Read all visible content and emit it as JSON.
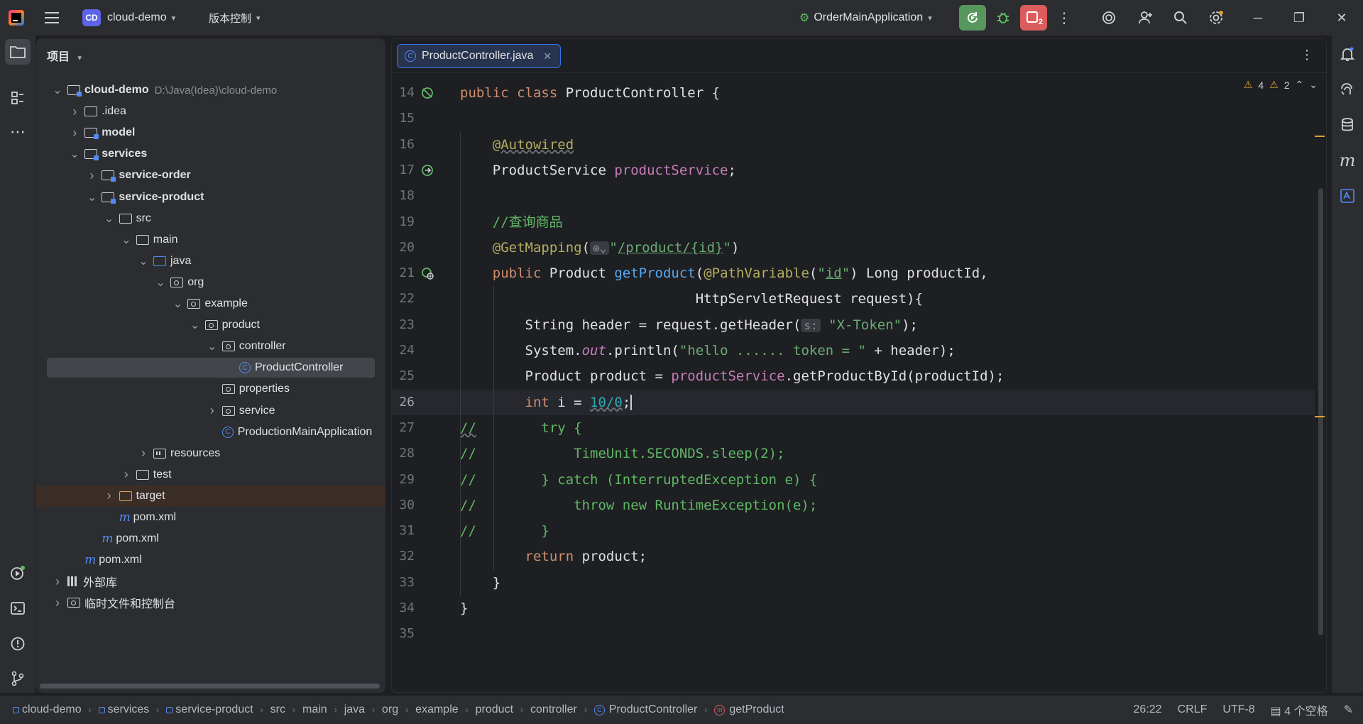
{
  "titlebar": {
    "project_initials": "CD",
    "project_name": "cloud-demo",
    "vcs_label": "版本控制",
    "run_config": "OrderMainApplication",
    "stop_badge": "2"
  },
  "project_panel": {
    "title": "项目",
    "tree": [
      {
        "label": "cloud-demo",
        "path": "D:\\Java(Idea)\\cloud-demo",
        "bold": true,
        "indent": 0,
        "arrow": "down",
        "icon": "module"
      },
      {
        "label": ".idea",
        "indent": 1,
        "arrow": "right",
        "icon": "folder"
      },
      {
        "label": "model",
        "bold": true,
        "indent": 1,
        "arrow": "right",
        "icon": "module"
      },
      {
        "label": "services",
        "bold": true,
        "indent": 1,
        "arrow": "down",
        "icon": "module"
      },
      {
        "label": "service-order",
        "bold": true,
        "indent": 2,
        "arrow": "right",
        "icon": "module"
      },
      {
        "label": "service-product",
        "bold": true,
        "indent": 2,
        "arrow": "down",
        "icon": "module"
      },
      {
        "label": "src",
        "indent": 3,
        "arrow": "down",
        "icon": "folder"
      },
      {
        "label": "main",
        "indent": 4,
        "arrow": "down",
        "icon": "folder"
      },
      {
        "label": "java",
        "indent": 5,
        "arrow": "down",
        "icon": "source"
      },
      {
        "label": "org",
        "indent": 6,
        "arrow": "down",
        "icon": "package"
      },
      {
        "label": "example",
        "indent": 7,
        "arrow": "down",
        "icon": "package"
      },
      {
        "label": "product",
        "indent": 8,
        "arrow": "down",
        "icon": "package"
      },
      {
        "label": "controller",
        "indent": 9,
        "arrow": "down",
        "icon": "package"
      },
      {
        "label": "ProductController",
        "indent": 10,
        "arrow": "",
        "icon": "class",
        "selected": true
      },
      {
        "label": "properties",
        "indent": 9,
        "arrow": "",
        "icon": "package"
      },
      {
        "label": "service",
        "indent": 9,
        "arrow": "right",
        "icon": "package"
      },
      {
        "label": "ProductionMainApplication",
        "indent": 9,
        "arrow": "",
        "icon": "class"
      },
      {
        "label": "resources",
        "indent": 5,
        "arrow": "right",
        "icon": "resources"
      },
      {
        "label": "test",
        "indent": 4,
        "arrow": "right",
        "icon": "folder"
      },
      {
        "label": "target",
        "indent": 3,
        "arrow": "right",
        "icon": "excluded",
        "target": true
      },
      {
        "label": "pom.xml",
        "indent": 3,
        "arrow": "",
        "icon": "maven"
      },
      {
        "label": "pom.xml",
        "indent": 2,
        "arrow": "",
        "icon": "maven"
      },
      {
        "label": "pom.xml",
        "indent": 1,
        "arrow": "",
        "icon": "maven"
      },
      {
        "label": "外部库",
        "indent": 0,
        "arrow": "right",
        "icon": "library"
      },
      {
        "label": "临时文件和控制台",
        "indent": 0,
        "arrow": "right",
        "icon": "scratch"
      }
    ]
  },
  "editor": {
    "tab_label": "ProductController.java",
    "warnings_a": "4",
    "warnings_b": "2",
    "lines": [
      {
        "n": "14",
        "html": "<span class=\"kw\">public class</span> ProductController {"
      },
      {
        "n": "15",
        "html": ""
      },
      {
        "n": "16",
        "html": "    <span class=\"an und\">@Autowired</span>"
      },
      {
        "n": "17",
        "html": "    ProductService <span class=\"fld\">productService</span>;"
      },
      {
        "n": "18",
        "html": ""
      },
      {
        "n": "19",
        "html": "    <span class=\"cmg\">//查询商品</span>"
      },
      {
        "n": "20",
        "html": "    <span class=\"an\">@GetMapping</span>(<span class=\"hint\">⊕⌄</span><span class=\"str\">\"<u>/product/{id}</u>\"</span>)"
      },
      {
        "n": "21",
        "html": "    <span class=\"kw\">public</span> Product <span class=\"fn\">getProduct</span>(<span class=\"an\">@PathVariable</span>(<span class=\"str\">\"<u>id</u>\"</span>) Long productId,"
      },
      {
        "n": "22",
        "html": "                             HttpServletRequest request){"
      },
      {
        "n": "23",
        "html": "        String header = request.getHeader(<span class=\"hint\">s:</span> <span class=\"str\">\"X-Token\"</span>);"
      },
      {
        "n": "24",
        "html": "        System.<span class=\"fld it\">out</span>.println(<span class=\"str\">\"hello ...... token = \"</span> + header);"
      },
      {
        "n": "25",
        "html": "        Product product = <span class=\"fld\">productService</span>.getProductById(productId);"
      },
      {
        "n": "26",
        "html": "        <span class=\"kw\">int</span> i = <span class=\"num und\">10/0</span>;<span class=\"caret\"></span>"
      },
      {
        "n": "27",
        "html": "<span class=\"cmg\"><span class=\"und\">//</span>        try {</span>"
      },
      {
        "n": "28",
        "html": "<span class=\"cmg\">//            TimeUnit.SECONDS.sleep(2);</span>"
      },
      {
        "n": "29",
        "html": "<span class=\"cmg\">//        } catch (InterruptedException e) {</span>"
      },
      {
        "n": "30",
        "html": "<span class=\"cmg\">//            throw new RuntimeException(e);</span>"
      },
      {
        "n": "31",
        "html": "<span class=\"cmg\">//        }</span>"
      },
      {
        "n": "32",
        "html": "        <span class=\"kw\">return</span> product;"
      },
      {
        "n": "33",
        "html": "    }"
      },
      {
        "n": "34",
        "html": "}"
      },
      {
        "n": "35",
        "html": ""
      }
    ],
    "current_line": "26"
  },
  "statusbar": {
    "breadcrumbs": [
      {
        "label": "cloud-demo",
        "icon": "module"
      },
      {
        "label": "services",
        "icon": "module"
      },
      {
        "label": "service-product",
        "icon": "module"
      },
      {
        "label": "src",
        "icon": ""
      },
      {
        "label": "main",
        "icon": ""
      },
      {
        "label": "java",
        "icon": ""
      },
      {
        "label": "org",
        "icon": ""
      },
      {
        "label": "example",
        "icon": ""
      },
      {
        "label": "product",
        "icon": ""
      },
      {
        "label": "controller",
        "icon": ""
      },
      {
        "label": "ProductController",
        "icon": "class"
      },
      {
        "label": "getProduct",
        "icon": "method"
      }
    ],
    "position": "26:22",
    "line_sep": "CRLF",
    "encoding": "UTF-8",
    "indent": "4 个空格"
  }
}
